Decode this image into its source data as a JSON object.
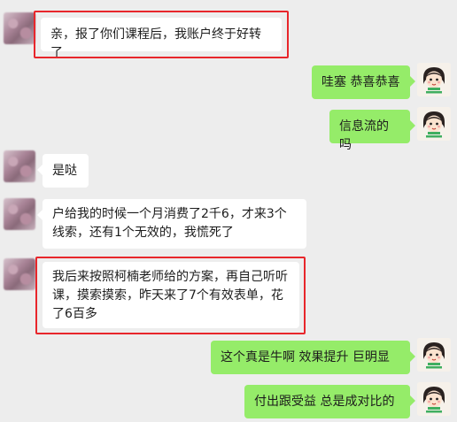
{
  "conversation": {
    "messages": [
      {
        "side": "left",
        "text": "亲，报了你们课程后，我账户终于好转了"
      },
      {
        "side": "right",
        "text": "哇塞  恭喜恭喜"
      },
      {
        "side": "right",
        "text": "信息流的吗"
      },
      {
        "side": "left",
        "text": "是哒"
      },
      {
        "side": "left",
        "text": "户给我的时候一个月消费了2千6，才来3个线索，还有1个无效的，我慌死了"
      },
      {
        "side": "left",
        "text": "我后来按照柯楠老师给的方案，再自己听听课，摸索摸索，昨天来了7个有效表单，花了6百多"
      },
      {
        "side": "right",
        "text": "这个真是牛啊  效果提升   巨明显"
      },
      {
        "side": "right",
        "text": "付出跟受益 总是成对比的"
      }
    ]
  },
  "colors": {
    "background": "#ededed",
    "bubble_left": "#ffffff",
    "bubble_right": "#95ec69",
    "highlight": "#e8262b"
  },
  "icons": {
    "left_avatar": "blurred-user-avatar",
    "right_avatar": "cartoon-girl-avatar"
  }
}
